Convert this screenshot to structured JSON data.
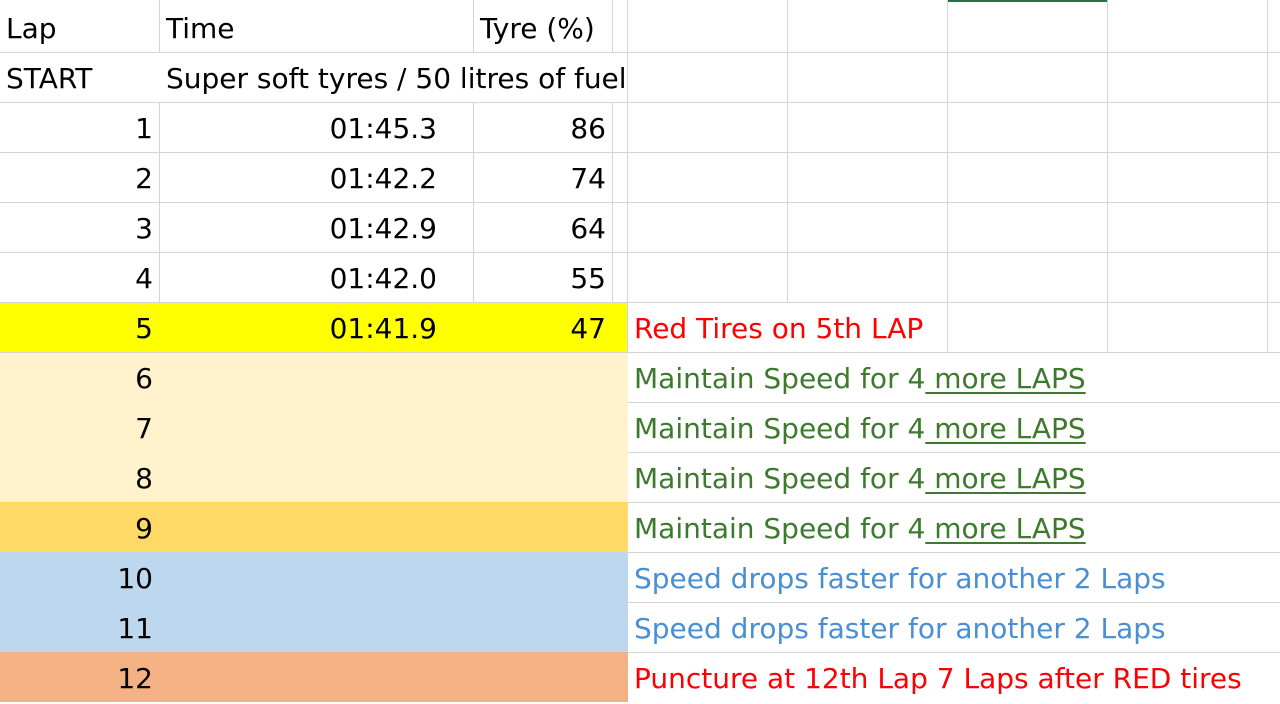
{
  "columns": {
    "lap": "Lap",
    "time": "Time",
    "tyre": "Tyre (%)"
  },
  "start_row": {
    "label": "START",
    "text": "Super soft tyres / 50 litres of fuel"
  },
  "laps": [
    {
      "lap": "1",
      "time": "01:45.3",
      "tyre": "86"
    },
    {
      "lap": "2",
      "time": "01:42.2",
      "tyre": "74"
    },
    {
      "lap": "3",
      "time": "01:42.9",
      "tyre": "64"
    },
    {
      "lap": "4",
      "time": "01:42.0",
      "tyre": "55"
    },
    {
      "lap": "5",
      "time": "01:41.9",
      "tyre": "47",
      "note": "Red Tires on 5th LAP"
    },
    {
      "lap": "6",
      "note_a": "Maintain Speed for 4",
      "note_b": " more LAPS"
    },
    {
      "lap": "7",
      "note_a": "Maintain Speed for 4",
      "note_b": " more LAPS"
    },
    {
      "lap": "8",
      "note_a": "Maintain Speed for 4",
      "note_b": " more LAPS"
    },
    {
      "lap": "9",
      "note_a": "Maintain Speed for 4",
      "note_b": " more LAPS"
    },
    {
      "lap": "10",
      "note": "Speed drops faster for another 2 Laps"
    },
    {
      "lap": "11",
      "note": "Speed drops faster for another 2 Laps"
    },
    {
      "lap": "12",
      "note": "Puncture at 12th Lap 7 Laps after RED tires"
    }
  ],
  "colors": {
    "grid": "#d4d4d4",
    "yellow_row": "#ffff00",
    "cream_rows": "#fff2cc",
    "gold_row": "#ffd966",
    "blue_rows": "#bdd7ee",
    "orange_row": "#f4b183",
    "note_red": "#ff0000",
    "note_green": "#3d7a2e",
    "note_blue": "#4a8fd4",
    "selection": "#217346"
  }
}
